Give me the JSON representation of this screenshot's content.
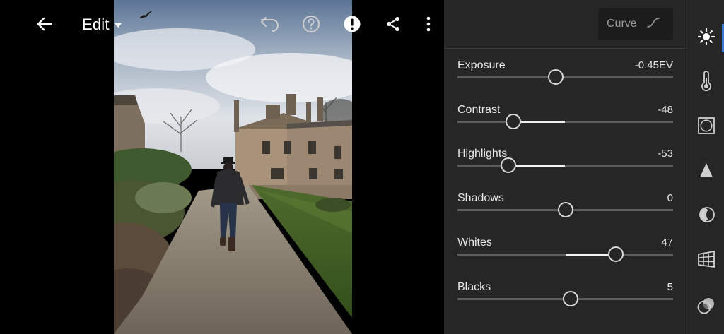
{
  "header": {
    "edit_label": "Edit"
  },
  "icons": {
    "back": "arrow-left-icon",
    "edit_caret": "caret-down-icon",
    "undo": "undo-icon",
    "help": "help-icon",
    "alert": "alert-icon",
    "share": "share-icon",
    "more": "more-vertical-icon",
    "curve": "curve-icon"
  },
  "panel": {
    "curve_label": "Curve",
    "adjustments": [
      {
        "name": "Exposure",
        "value": "-0.45EV",
        "position": 0.455,
        "numeric": -0.45
      },
      {
        "name": "Contrast",
        "value": "-48",
        "position": 0.26,
        "numeric": -48
      },
      {
        "name": "Highlights",
        "value": "-53",
        "position": 0.235,
        "numeric": -53
      },
      {
        "name": "Shadows",
        "value": "0",
        "position": 0.5,
        "numeric": 0
      },
      {
        "name": "Whites",
        "value": "47",
        "position": 0.735,
        "numeric": 47
      },
      {
        "name": "Blacks",
        "value": "5",
        "position": 0.525,
        "numeric": 5
      }
    ]
  },
  "rail": {
    "tools": [
      "light-icon",
      "color-temperature-icon",
      "vignette-icon",
      "detail-icon",
      "optics-icon",
      "geometry-icon",
      "mask-icon"
    ],
    "active": "light-icon"
  },
  "colors": {
    "panel_bg": "#262626",
    "track": "#5d5d5d",
    "fill": "#f2f2f2",
    "active_accent": "#3d7bd9"
  }
}
